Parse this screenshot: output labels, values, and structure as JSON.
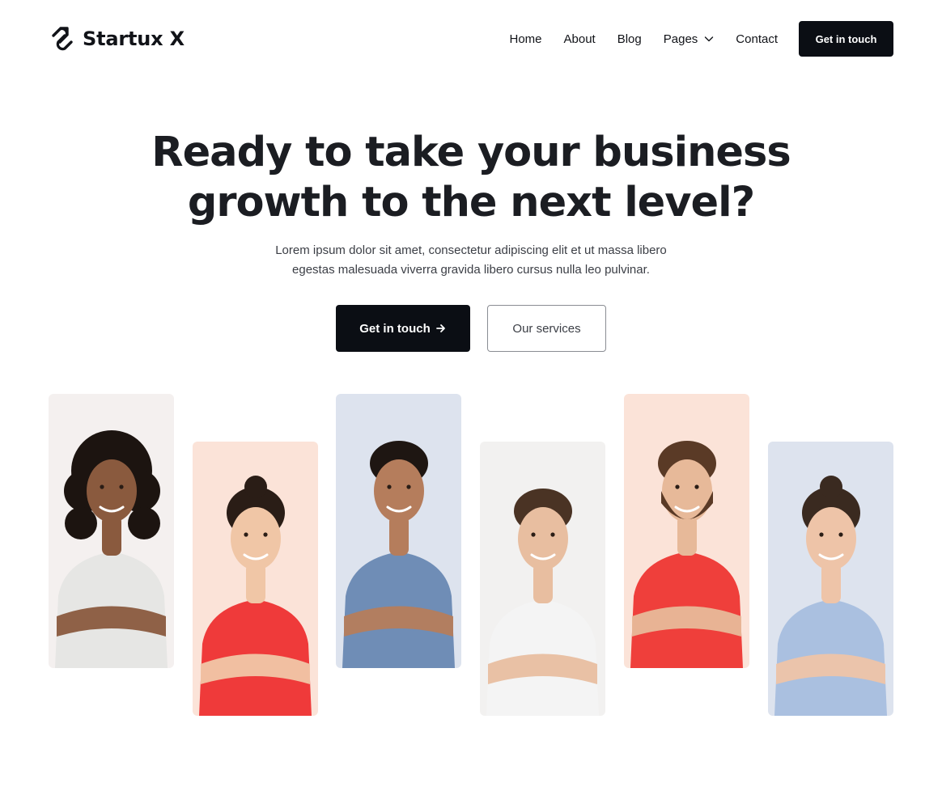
{
  "header": {
    "logo_text": "Startux X",
    "nav": [
      {
        "label": "Home"
      },
      {
        "label": "About"
      },
      {
        "label": "Blog"
      },
      {
        "label": "Pages",
        "dropdown": true
      },
      {
        "label": "Contact"
      }
    ],
    "cta_label": "Get in touch"
  },
  "hero": {
    "title_line1": "Ready to take your business",
    "title_line2": "growth to the next level?",
    "subtitle_line1": "Lorem ipsum dolor sit amet, consectetur adipiscing elit et ut massa libero",
    "subtitle_line2": "egestas malesuada viverra gravida libero cursus nulla leo pulvinar.",
    "primary_button": "Get in touch",
    "primary_button_icon": "arrow-right-icon",
    "secondary_button": "Our services"
  },
  "team": [
    {
      "bg": "#f4f0ef",
      "shirt": "#e6e6e4",
      "skin": "#8a5a3e",
      "hair": "#1c1410",
      "hair_style": "curly"
    },
    {
      "bg": "#fbe3d8",
      "shirt": "#ef3a3a",
      "skin": "#f0c6a6",
      "hair": "#2a1d16",
      "hair_style": "bun"
    },
    {
      "bg": "#dde3ee",
      "shirt": "#6f8db6",
      "skin": "#b57d5c",
      "hair": "#1e1612",
      "hair_style": "short"
    },
    {
      "bg": "#f2f1f0",
      "shirt": "#f4f4f4",
      "skin": "#e8bea0",
      "hair": "#4a3324",
      "hair_style": "short"
    },
    {
      "bg": "#fbe3d8",
      "shirt": "#ef3f3b",
      "skin": "#e7b999",
      "hair": "#5a3a26",
      "hair_style": "beard"
    },
    {
      "bg": "#dde3ee",
      "shirt": "#aac0e0",
      "skin": "#eec4a8",
      "hair": "#3a2a20",
      "hair_style": "bun"
    }
  ],
  "colors": {
    "dark": "#0b0e14",
    "text": "#1b1d22",
    "muted": "#3b3e45"
  }
}
